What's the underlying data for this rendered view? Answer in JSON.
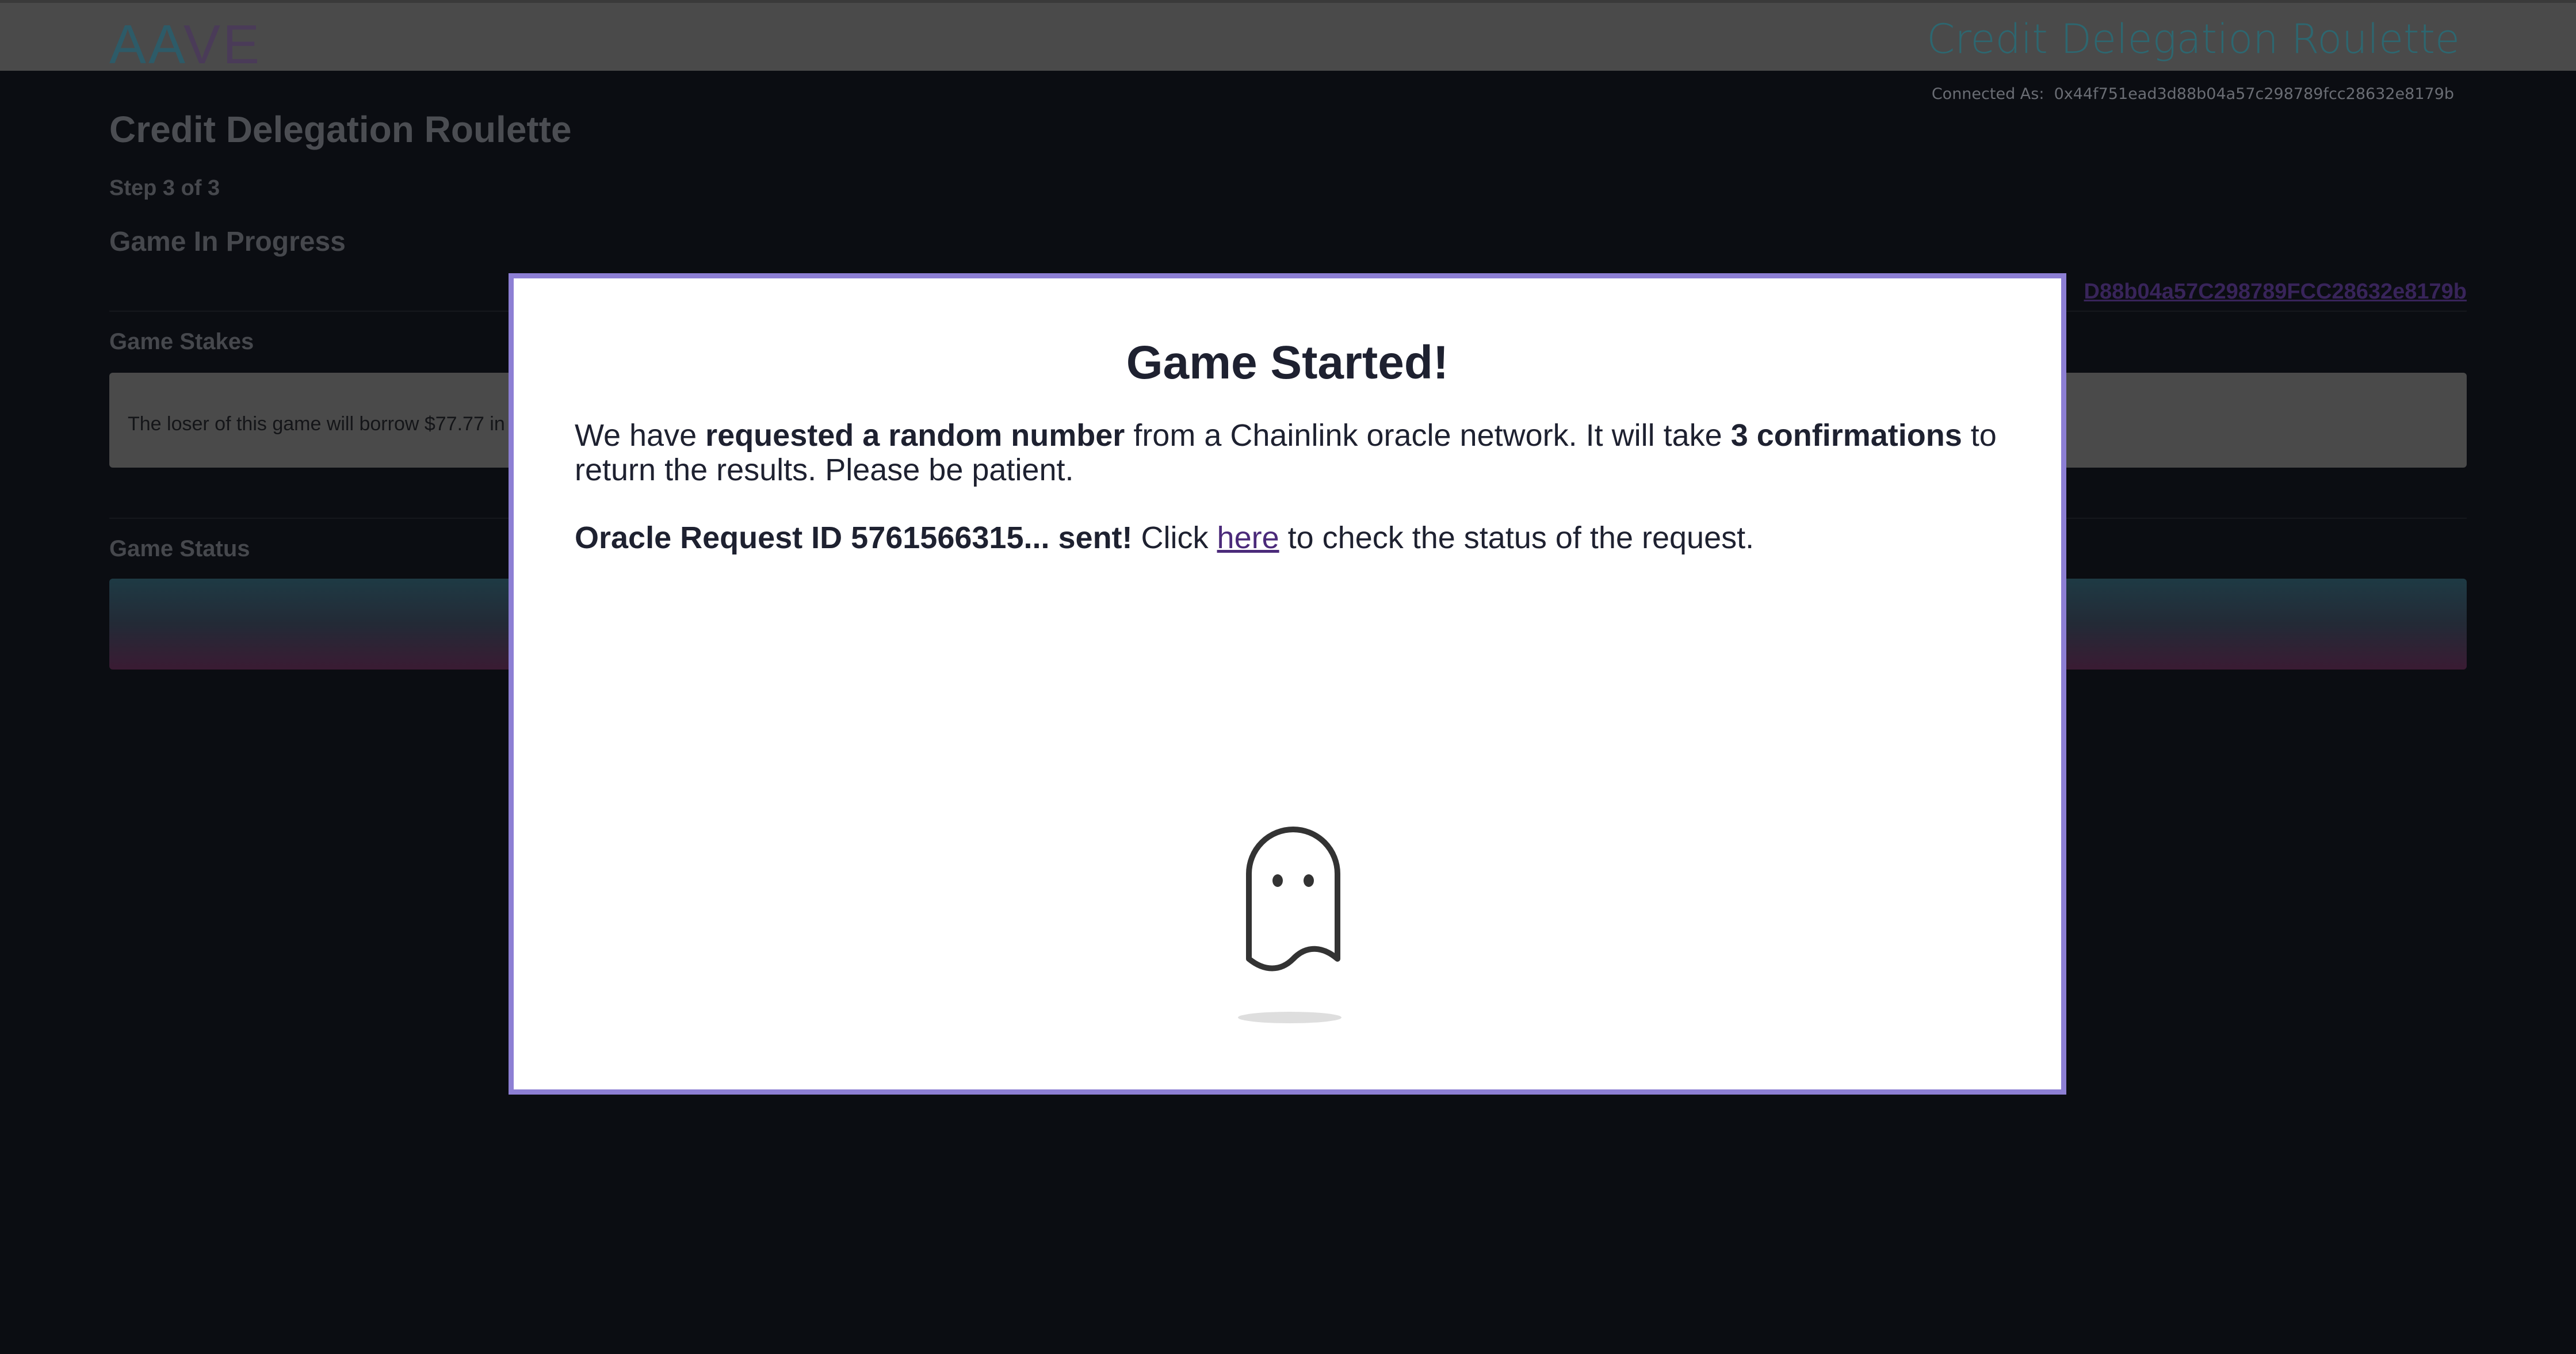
{
  "header": {
    "logo_a": "AA",
    "logo_ve": "VE",
    "app_title": "Credit Delegation Roulette",
    "connected_label": "Connected As:",
    "connected_address": "0x44f751ead3d88b04a57c298789fcc28632e8179b"
  },
  "page": {
    "title": "Credit Delegation Roulette",
    "step": "Step 3 of 3",
    "subtitle": "Game In Progress",
    "address_link": "D88b04a57C298789FCC28632e8179b",
    "stakes_heading": "Game Stakes",
    "stakes_text": "The loser of this game will borrow $77.77 in",
    "status_heading": "Game Status"
  },
  "modal": {
    "title": "Game Started!",
    "p1": {
      "t1": "We have ",
      "b1": "requested a random number",
      "t2": " from a Chainlink oracle network. It will take ",
      "b2": "3 confirmations",
      "t3": " to return the results. Please be patient."
    },
    "p2": {
      "b1": "Oracle Request ID 5761566315... sent!",
      "t1": " Click ",
      "link": "here",
      "t2": " to check the status of the request."
    },
    "icon": "ghost-icon"
  },
  "colors": {
    "modal_border": "#8d7fd4",
    "link": "#4b2a7a",
    "text": "#1e2130"
  }
}
